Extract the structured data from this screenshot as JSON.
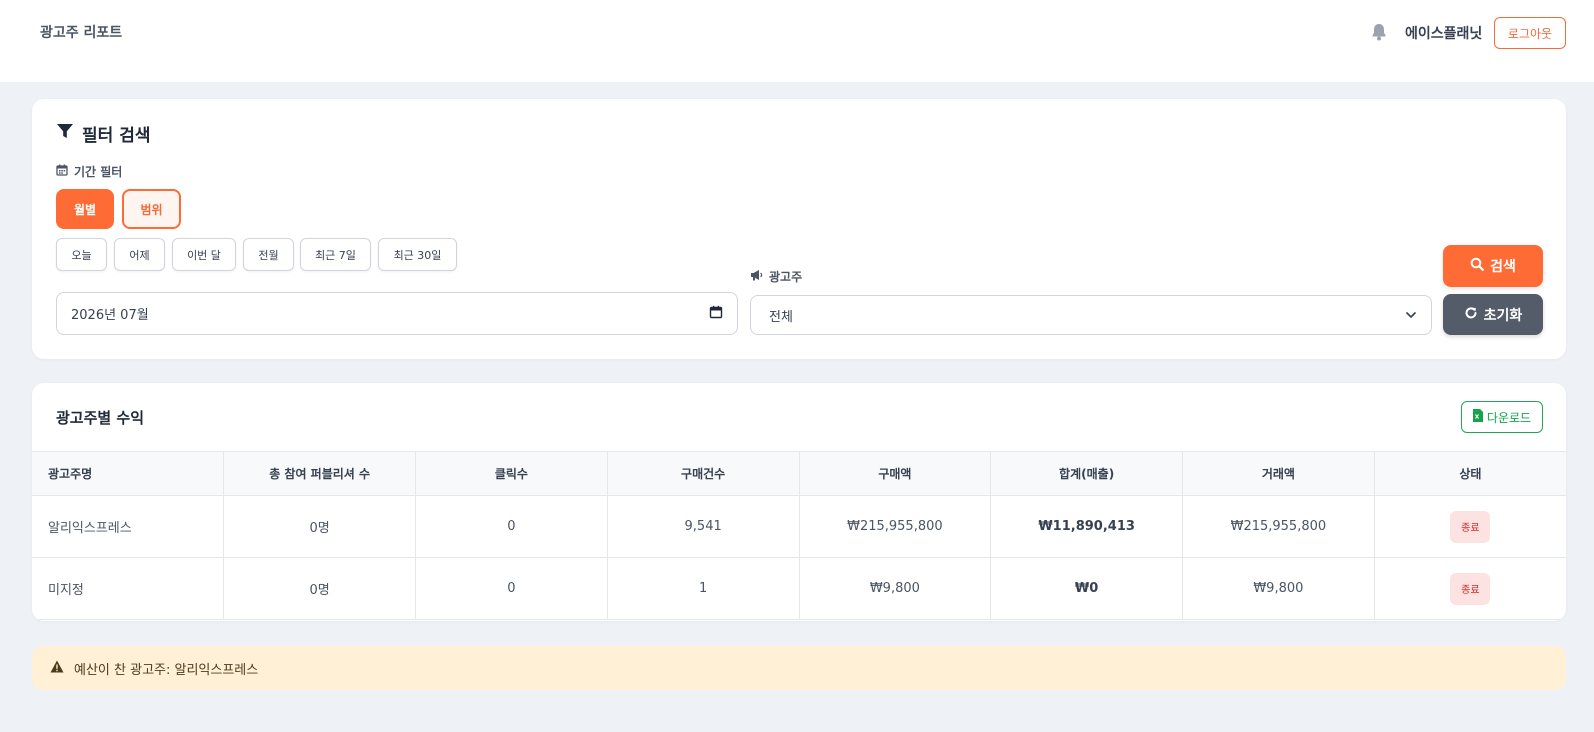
{
  "header": {
    "brand": "광고주 리포트",
    "company": "에이스플래닛",
    "logout_label": "로그아웃",
    "icons": [
      "bell-icon"
    ]
  },
  "filter": {
    "title": "필터 검색",
    "period_label": "기간 필터",
    "modes": [
      "월별",
      "범위"
    ],
    "active_mode": "월별",
    "quick_buttons": [
      "오늘",
      "어제",
      "이번 달",
      "전월",
      "최근 7일",
      "최근 30일"
    ],
    "month_value": "2026년 07월",
    "advertiser_label": "광고주",
    "advertiser_selected": "전체",
    "search_label": "검색",
    "reset_label": "초기화",
    "icons": [
      "filter-icon",
      "calendar-icon",
      "megaphone-icon",
      "search-icon",
      "refresh-icon",
      "chevron-down-icon"
    ]
  },
  "revenue": {
    "title": "광고주별 수익",
    "download_label": "다운로드",
    "columns": [
      "광고주명",
      "총 참여 퍼블리셔 수",
      "클릭수",
      "구매건수",
      "구매액",
      "합계(매출)",
      "거래액",
      "상태"
    ],
    "rows": [
      {
        "name": "알리익스프레스",
        "publishers": "0명",
        "clicks": "0",
        "purchases": "9,541",
        "purchase_amount": "₩215,955,800",
        "total": "₩11,890,413",
        "transaction": "₩215,955,800",
        "status": "종료"
      },
      {
        "name": "미지정",
        "publishers": "0명",
        "clicks": "0",
        "purchases": "1",
        "purchase_amount": "₩9,800",
        "total": "₩0",
        "transaction": "₩9,800",
        "status": "종료"
      }
    ]
  },
  "alert": {
    "text": "예산이 찬 광고주: 알리익스프레스"
  },
  "colors": {
    "accent": "#ff6b35",
    "reset": "#545b69",
    "download": "#16a34a",
    "status_ended_bg": "#fde2e2",
    "alert_bg": "#fff0d6"
  }
}
